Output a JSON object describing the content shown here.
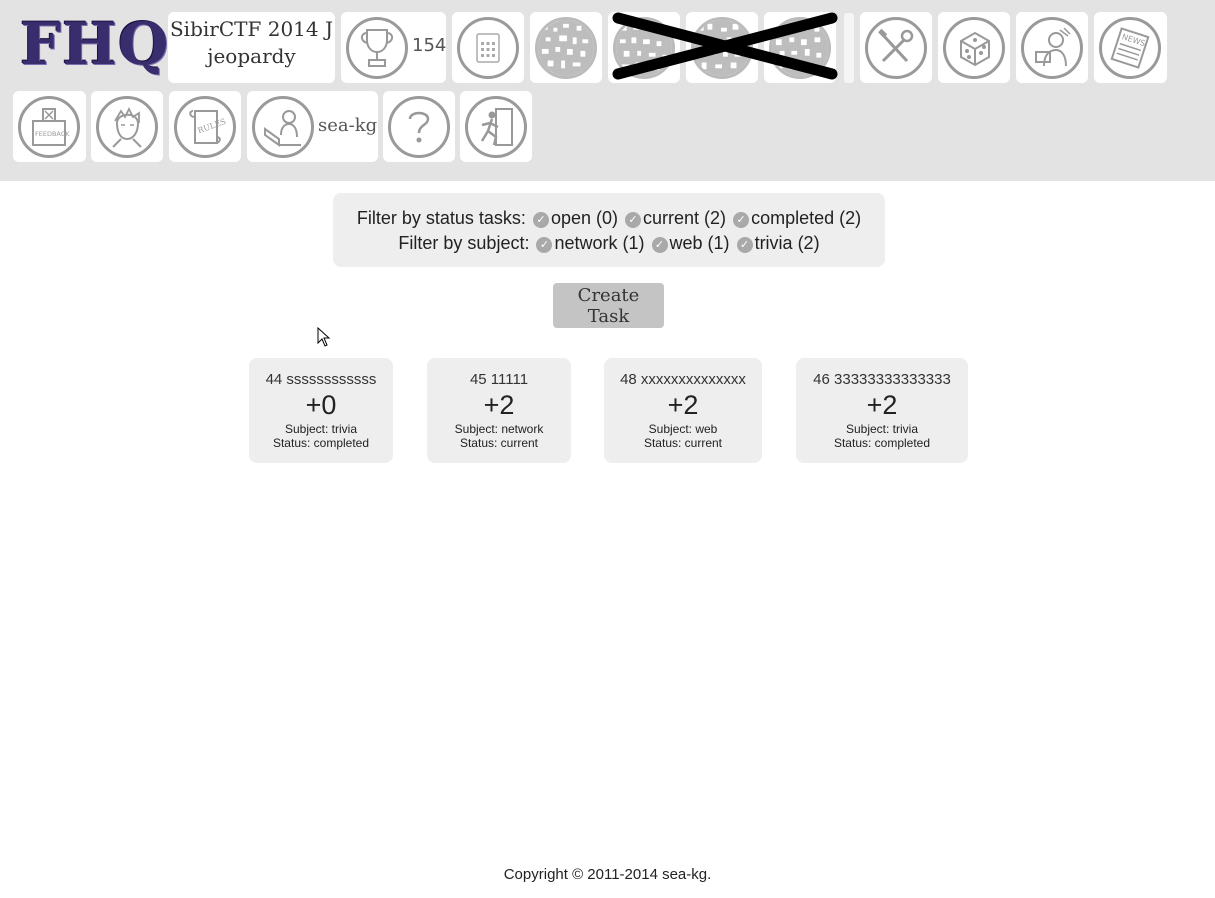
{
  "header": {
    "logo_text": "FHQ",
    "game_title_line1": "SibirCTF 2014 J",
    "game_title_line2": "jeopardy",
    "score": "154",
    "username": "sea-kg",
    "icons": [
      "logo",
      "trophy-icon",
      "calculator-icon",
      "qr-code-icon",
      "tools-icon",
      "dice-icon",
      "admin-person-icon",
      "news-icon",
      "feedback-box-icon",
      "profile-face-icon",
      "rules-scroll-icon",
      "user-laptop-icon",
      "help-question-icon",
      "exit-running-icon"
    ]
  },
  "filters": {
    "status_label": "Filter by status tasks:",
    "status_options": [
      {
        "label": "open (0)"
      },
      {
        "label": "current (2)"
      },
      {
        "label": "completed (2)"
      }
    ],
    "subject_label": "Filter by subject:",
    "subject_options": [
      {
        "label": "network (1)"
      },
      {
        "label": "web (1)"
      },
      {
        "label": "trivia (2)"
      }
    ]
  },
  "create_task_label": "Create Task",
  "tasks": [
    {
      "name": "44 ssssssssssss",
      "score": "+0",
      "subject": "Subject: trivia",
      "status": "Status: completed"
    },
    {
      "name": "45 11111",
      "score": "+2",
      "subject": "Subject: network",
      "status": "Status: current"
    },
    {
      "name": "48 xxxxxxxxxxxxxx",
      "score": "+2",
      "subject": "Subject: web",
      "status": "Status: current"
    },
    {
      "name": "46 33333333333333",
      "score": "+2",
      "subject": "Subject: trivia",
      "status": "Status: completed"
    }
  ],
  "footer": "Copyright © 2011-2014 sea-kg."
}
